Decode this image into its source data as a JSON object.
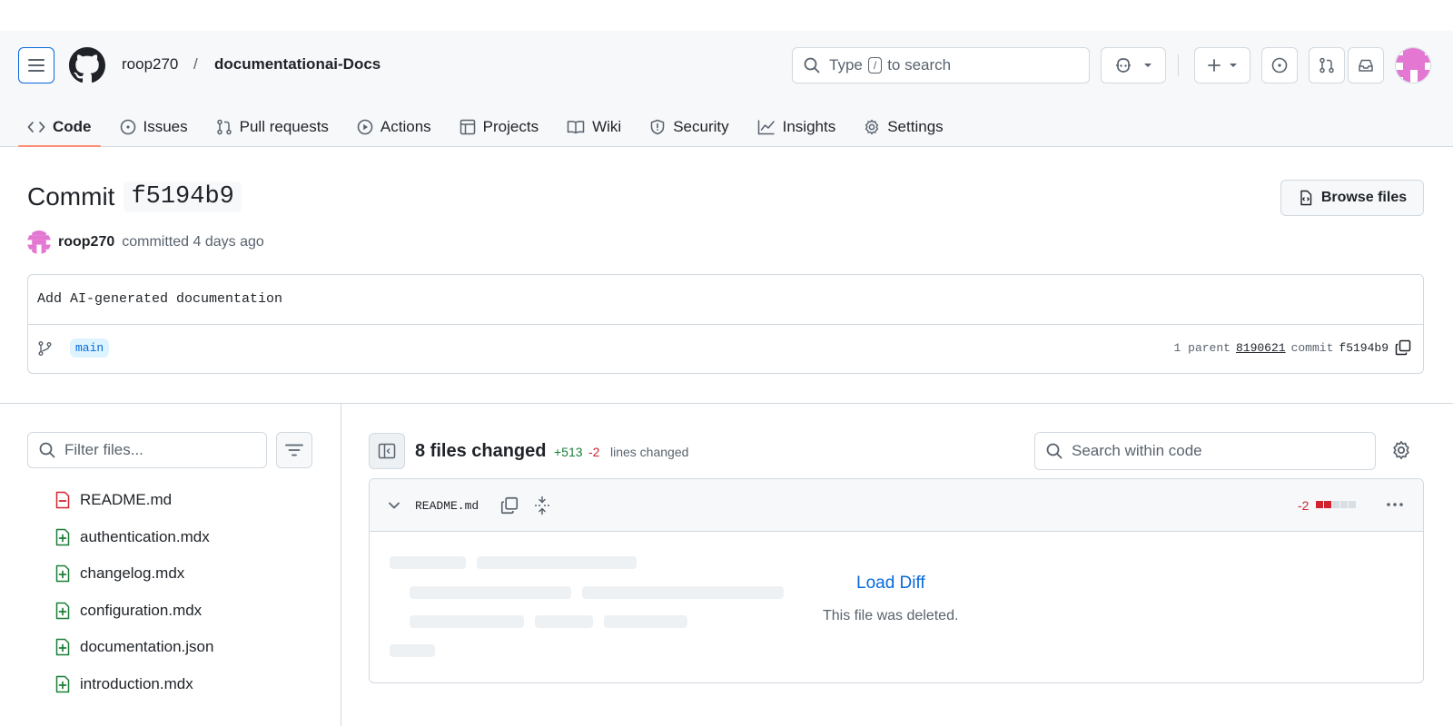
{
  "header": {
    "owner": "roop270",
    "separator": "/",
    "repo": "documentationai-Docs",
    "search_prefix": "Type",
    "search_key": "/",
    "search_suffix": "to search"
  },
  "tabs": [
    {
      "label": "Code",
      "icon": "code-icon",
      "active": true
    },
    {
      "label": "Issues",
      "icon": "issue-icon"
    },
    {
      "label": "Pull requests",
      "icon": "pull-request-icon"
    },
    {
      "label": "Actions",
      "icon": "play-icon"
    },
    {
      "label": "Projects",
      "icon": "table-icon"
    },
    {
      "label": "Wiki",
      "icon": "book-icon"
    },
    {
      "label": "Security",
      "icon": "shield-icon"
    },
    {
      "label": "Insights",
      "icon": "graph-icon"
    },
    {
      "label": "Settings",
      "icon": "gear-icon"
    }
  ],
  "commit": {
    "title_prefix": "Commit",
    "sha": "f5194b9",
    "browse_label": "Browse files",
    "author": "roop270",
    "meta": "committed 4 days ago",
    "message": "Add AI-generated documentation",
    "branch": "main",
    "parent_count_label": "1 parent",
    "parent_sha": "8190621",
    "commit_label": "commit",
    "commit_sha": "f5194b9"
  },
  "sidebar": {
    "filter_placeholder": "Filter files...",
    "files": [
      {
        "name": "README.md",
        "status": "deleted"
      },
      {
        "name": "authentication.mdx",
        "status": "added"
      },
      {
        "name": "changelog.mdx",
        "status": "added"
      },
      {
        "name": "configuration.mdx",
        "status": "added"
      },
      {
        "name": "documentation.json",
        "status": "added"
      },
      {
        "name": "introduction.mdx",
        "status": "added"
      }
    ]
  },
  "diff_summary": {
    "files_changed": "8 files changed",
    "additions": "+513",
    "deletions": "-2",
    "lines_label": "lines changed",
    "search_placeholder": "Search within code"
  },
  "diff_file": {
    "name": "README.md",
    "deletions": "-2",
    "load_label": "Load Diff",
    "note": "This file was deleted."
  },
  "colors": {
    "accent": "#0969da",
    "added": "#1a7f37",
    "deleted": "#d1242f",
    "tab_underline": "#fd8c73",
    "avatar": "#e377d1"
  }
}
